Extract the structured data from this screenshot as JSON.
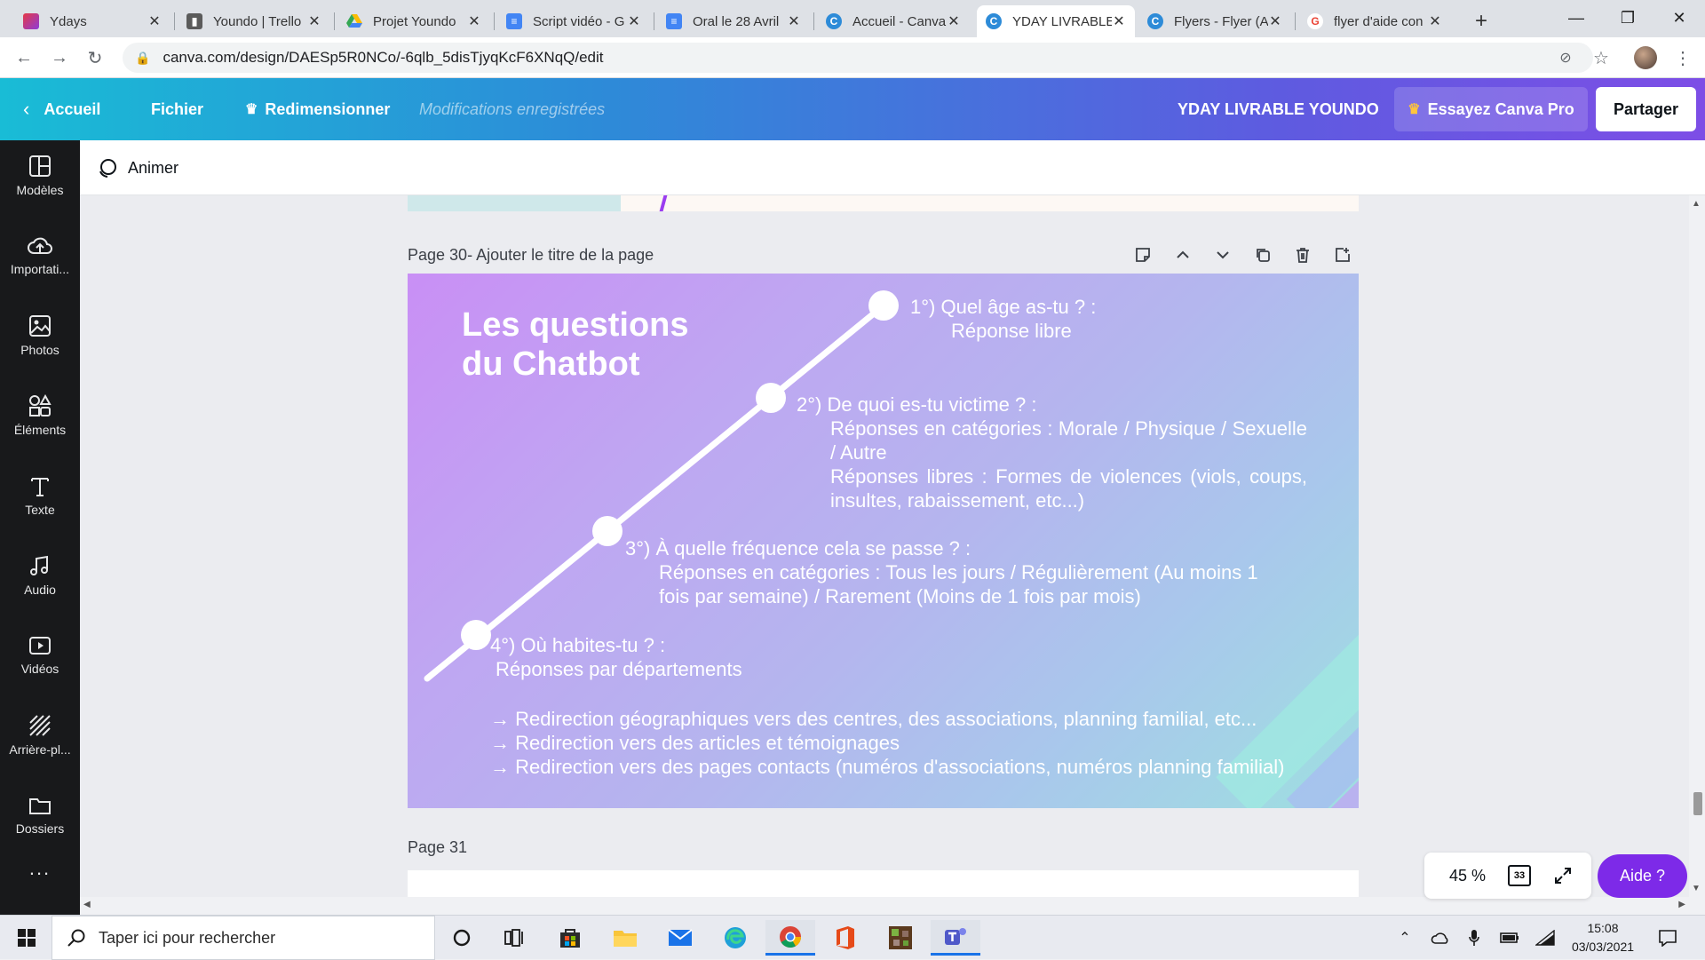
{
  "browser": {
    "tabs": [
      {
        "title": "Ydays",
        "icon": "ydays-icon",
        "color": "#d63b3b"
      },
      {
        "title": "Youndo | Trello",
        "icon": "trello-icon",
        "color": "#555555"
      },
      {
        "title": "Projet Youndo",
        "icon": "google-drive-icon",
        "color": "#f4b400"
      },
      {
        "title": "Script vidéo - G",
        "icon": "google-docs-icon",
        "color": "#4285f4"
      },
      {
        "title": "Oral le 28 Avril",
        "icon": "google-docs-icon",
        "color": "#4285f4"
      },
      {
        "title": "Accueil - Canva",
        "icon": "canva-icon",
        "color": "#2d8bd8"
      },
      {
        "title": "YDAY LIVRABLE",
        "icon": "canva-icon",
        "color": "#2d8bd8"
      },
      {
        "title": "Flyers - Flyer (A",
        "icon": "canva-icon",
        "color": "#2d8bd8"
      },
      {
        "title": "flyer d'aide con",
        "icon": "google-icon",
        "color": "#ea4335"
      }
    ],
    "url": "canva.com/design/DAESp5R0NCo/-6qlb_5disTjyqKcF6XNqQ/edit"
  },
  "header": {
    "home": "Accueil",
    "file": "Fichier",
    "resize": "Redimensionner",
    "saved": "Modifications enregistrées",
    "project": "YDAY LIVRABLE YOUNDO",
    "try_pro": "Essayez Canva Pro",
    "share": "Partager"
  },
  "sidebar": [
    {
      "label": "Modèles",
      "icon": "templates-icon"
    },
    {
      "label": "Importati...",
      "icon": "upload-cloud-icon"
    },
    {
      "label": "Photos",
      "icon": "photos-icon"
    },
    {
      "label": "Éléments",
      "icon": "elements-icon"
    },
    {
      "label": "Texte",
      "icon": "text-icon"
    },
    {
      "label": "Audio",
      "icon": "audio-icon"
    },
    {
      "label": "Vidéos",
      "icon": "video-icon"
    },
    {
      "label": "Arrière-pl...",
      "icon": "background-icon"
    },
    {
      "label": "Dossiers",
      "icon": "folder-icon"
    },
    {
      "label": "...",
      "icon": "more-icon"
    }
  ],
  "toolbar": {
    "animate": "Animer"
  },
  "page": {
    "number_label": "Page 30",
    "title_placeholder": " - Ajouter le titre de la page",
    "next_label": "Page 31"
  },
  "slide": {
    "title": "Les questions\ndu Chatbot",
    "questions": [
      {
        "q": "1°) Quel âge as-tu ? :",
        "lines": [
          "Réponse libre"
        ]
      },
      {
        "q": "2°) De quoi es-tu victime ? :",
        "lines": [
          "Réponses en catégories : Morale / Physique / Sexuelle / Autre",
          "Réponses libres : Formes de violences (viols, coups, insultes, rabaissement, etc...)"
        ]
      },
      {
        "q": "3°) À quelle fréquence cela se passe ? :",
        "lines": [
          "Réponses en catégories : Tous les jours / Régulièrement (Au moins 1 fois par semaine) / Rarement (Moins de 1 fois par mois)"
        ]
      },
      {
        "q": "4°) Où habites-tu ? :",
        "lines": [
          "Réponses par départements"
        ]
      }
    ],
    "redirections": [
      "→ Redirection géographiques vers des centres, des associations, planning familial, etc...",
      "→ Redirection vers des articles et témoignages",
      "→ Redirection vers des pages contacts (numéros d'associations, numéros planning familial)"
    ]
  },
  "bottom": {
    "zoom": "45 %",
    "page_count": "33",
    "help": "Aide ?"
  },
  "taskbar": {
    "search_placeholder": "Taper ici pour rechercher",
    "time": "15:08",
    "date": "03/03/2021"
  },
  "colors": {
    "canva_purple": "#7d2ae8",
    "sidebar_bg": "#18191b"
  }
}
